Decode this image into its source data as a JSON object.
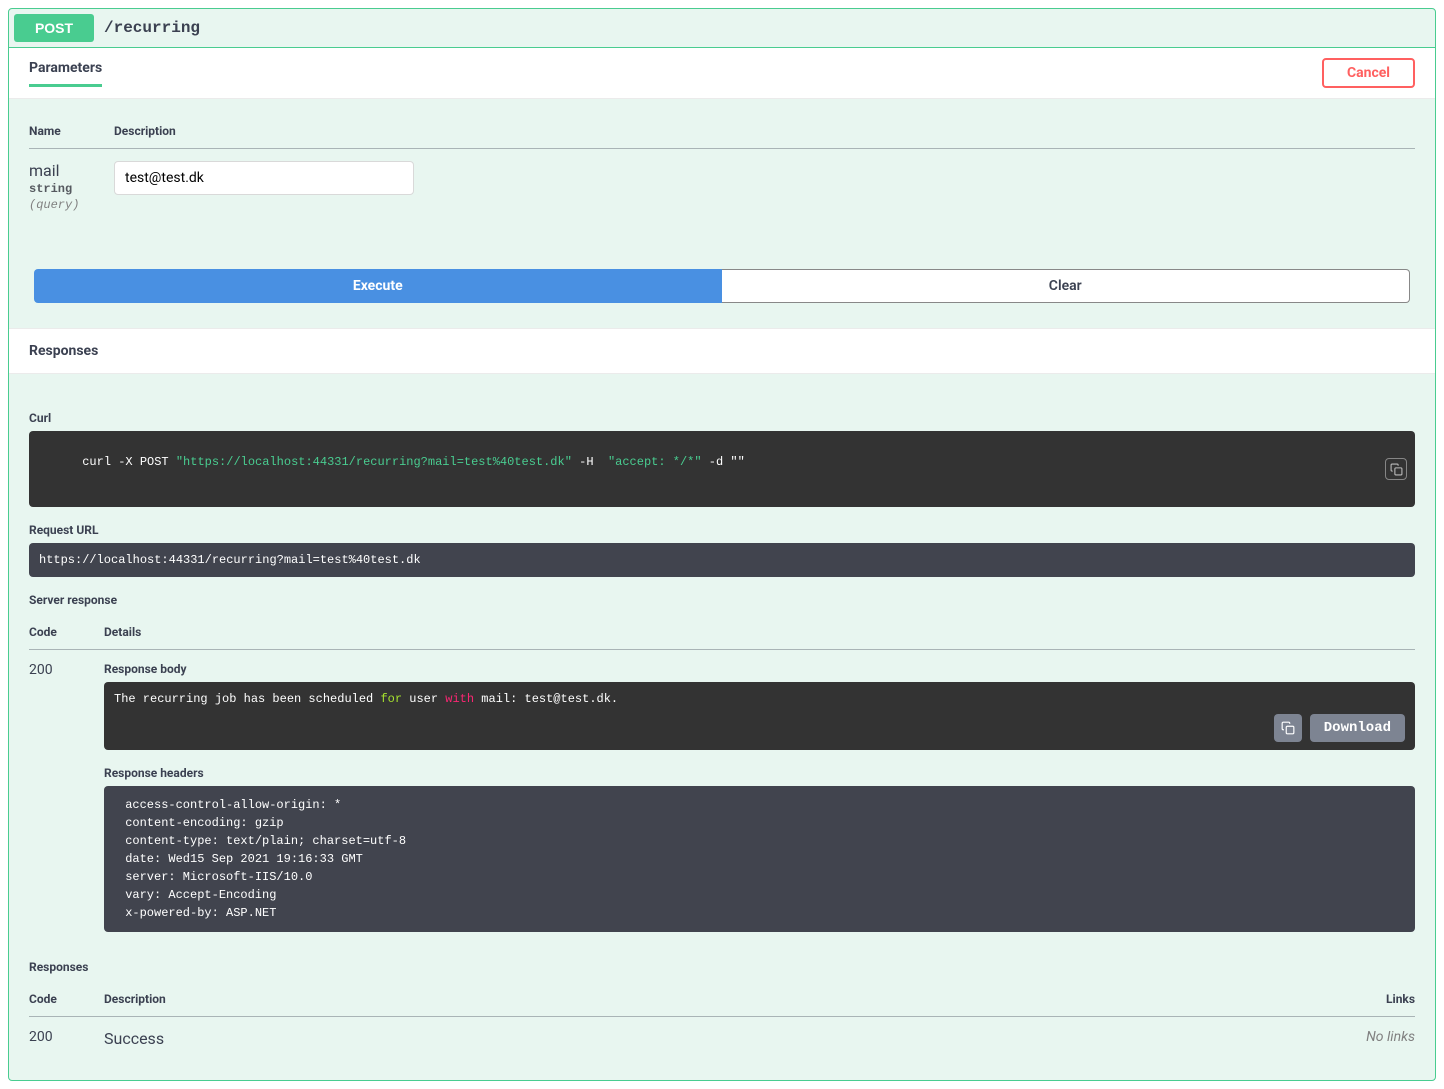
{
  "summary": {
    "method": "POST",
    "path": "/recurring"
  },
  "parameters": {
    "tab_label": "Parameters",
    "cancel_label": "Cancel",
    "headers": {
      "name": "Name",
      "description": "Description"
    },
    "items": [
      {
        "name": "mail",
        "type": "string",
        "in": "(query)",
        "value": "test@test.dk"
      }
    ]
  },
  "actions": {
    "execute": "Execute",
    "clear": "Clear"
  },
  "responses_label": "Responses",
  "curl": {
    "label": "Curl",
    "prefix": "curl -X POST ",
    "url": "\"https://localhost:44331/recurring?mail=test%40test.dk\"",
    "mid": " -H  ",
    "accept": "\"accept: */*\"",
    "suffix": " -d \"\""
  },
  "request_url": {
    "label": "Request URL",
    "value": "https://localhost:44331/recurring?mail=test%40test.dk"
  },
  "server_response": {
    "label": "Server response",
    "headers": {
      "code": "Code",
      "details": "Details"
    },
    "code": "200",
    "body_label": "Response body",
    "body_prefix": "The recurring job has been scheduled ",
    "body_for": "for",
    "body_user": " user ",
    "body_with": "with",
    "body_suffix": " mail: test@test.dk.",
    "download_label": "Download",
    "headers_label": "Response headers",
    "headers_text": " access-control-allow-origin: * \n content-encoding: gzip \n content-type: text/plain; charset=utf-8 \n date: Wed15 Sep 2021 19:16:33 GMT \n server: Microsoft-IIS/10.0 \n vary: Accept-Encoding \n x-powered-by: ASP.NET "
  },
  "documented_responses": {
    "label": "Responses",
    "headers": {
      "code": "Code",
      "description": "Description",
      "links": "Links"
    },
    "code": "200",
    "description": "Success",
    "no_links": "No links"
  }
}
